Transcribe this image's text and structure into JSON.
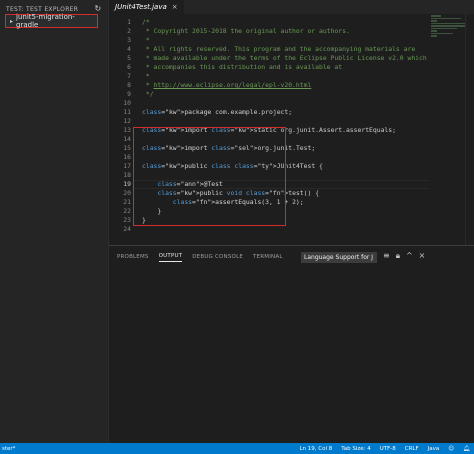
{
  "sidebar": {
    "header": "TEST: TEST EXPLORER",
    "refresh_icon": "refresh-icon",
    "items": [
      {
        "label": "junit5-migration-gradle",
        "expanded": false
      }
    ]
  },
  "editor": {
    "tab_label": "JUnit4Test.java",
    "tab_close": "×",
    "lines": [
      "/*",
      " * Copyright 2015-2018 the original author or authors.",
      " *",
      " * All rights reserved. This program and the accompanying materials are",
      " * made available under the terms of the Eclipse Public License v2.0 which",
      " * accompanies this distribution and is available at",
      " *",
      " * http://www.eclipse.org/legal/epl-v20.html",
      " */",
      "",
      "package com.example.project;",
      "",
      "import static org.junit.Assert.assertEquals;",
      "",
      "import org.junit.Test;",
      "",
      "public class JUnit4Test {",
      "",
      "    @Test",
      "    public void test() {",
      "        assertEquals(3, 1 + 2);",
      "    }",
      "}",
      ""
    ],
    "current_line": 19
  },
  "panel": {
    "tabs": [
      "PROBLEMS",
      "OUTPUT",
      "DEBUG CONSOLE",
      "TERMINAL"
    ],
    "active_tab": "OUTPUT",
    "channel": "Language Support for J"
  },
  "statusbar": {
    "left": "ster*",
    "position": "Ln 19, Col 8",
    "tab_size": "Tab Size: 4",
    "encoding": "UTF-8",
    "eol": "CRLF",
    "language": "Java"
  },
  "colors": {
    "highlight_box": "#d62b2b",
    "statusbar": "#007acc",
    "selection": "#264f78"
  }
}
